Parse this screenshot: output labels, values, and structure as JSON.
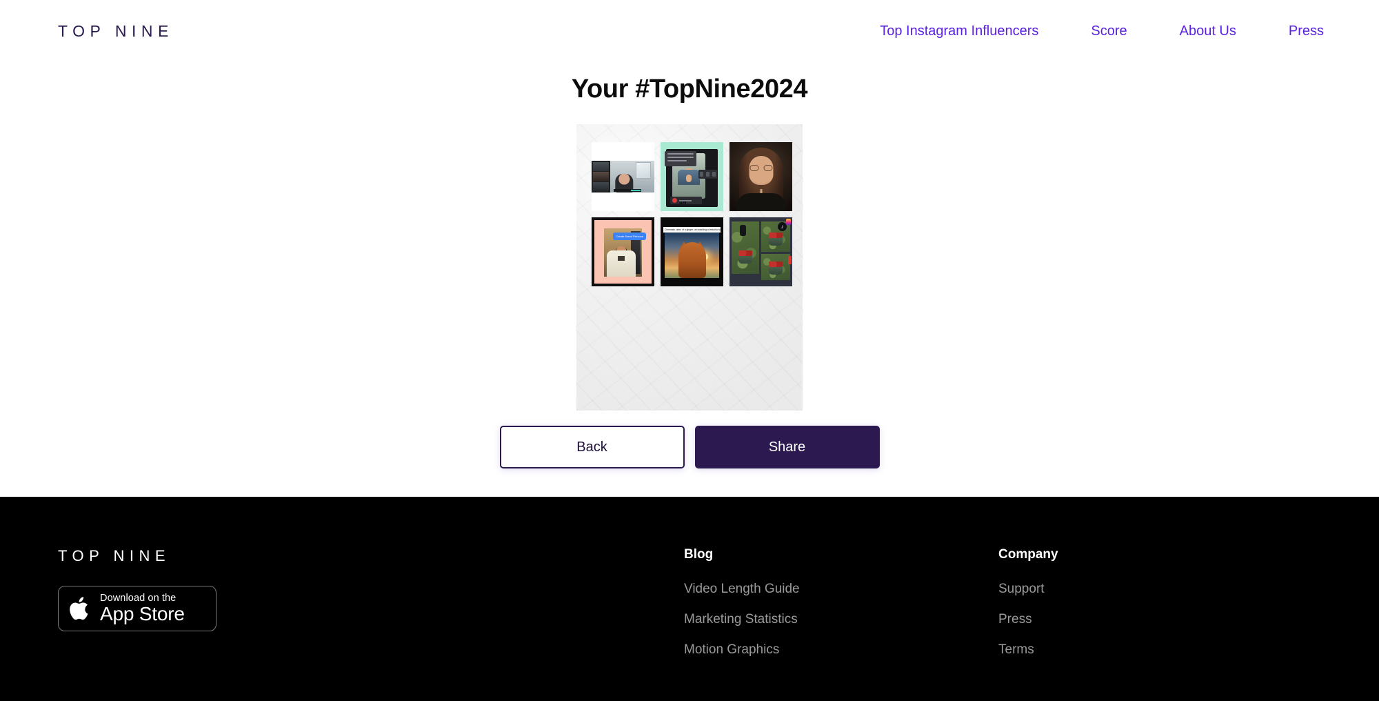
{
  "header": {
    "brand": "TOP NINE",
    "nav": [
      {
        "label": "Top Instagram Influencers"
      },
      {
        "label": "Score"
      },
      {
        "label": "About Us"
      },
      {
        "label": "Press"
      }
    ],
    "nav_color": "#5b21e0",
    "brand_color": "#2b1a4e"
  },
  "main": {
    "title": "Your #TopNine2024",
    "collage": {
      "background": "crumpled-paper",
      "rows": 2,
      "columns": 3,
      "tiles": [
        {
          "id": 1,
          "kind": "video-call-screenshot",
          "frame": "white",
          "caption": ""
        },
        {
          "id": 2,
          "kind": "teleprompter-recording",
          "frame": "mint-green",
          "caption": ""
        },
        {
          "id": 3,
          "kind": "portrait-photo",
          "frame": "black",
          "caption": ""
        },
        {
          "id": 4,
          "kind": "brand-persona-screenshot",
          "frame": "peach",
          "caption": "Create Brand Persona"
        },
        {
          "id": 5,
          "kind": "cat-sunset-video",
          "frame": "black",
          "caption": "Cinematic video of a ginger cat watching a beautiful sunset"
        },
        {
          "id": 6,
          "kind": "tiktok-collage",
          "frame": "dark-slate",
          "caption": ""
        }
      ]
    },
    "buttons": {
      "back": "Back",
      "share": "Share",
      "share_bg": "#2b1950"
    }
  },
  "footer": {
    "brand": "TOP NINE",
    "appstore": {
      "small": "Download on the",
      "large": "App Store",
      "icon": "apple-icon"
    },
    "columns": [
      {
        "heading": "Blog",
        "links": [
          {
            "label": "Video Length Guide"
          },
          {
            "label": "Marketing Statistics"
          },
          {
            "label": "Motion Graphics"
          }
        ]
      },
      {
        "heading": "Company",
        "links": [
          {
            "label": "Support"
          },
          {
            "label": "Press"
          },
          {
            "label": "Terms"
          }
        ]
      }
    ]
  }
}
